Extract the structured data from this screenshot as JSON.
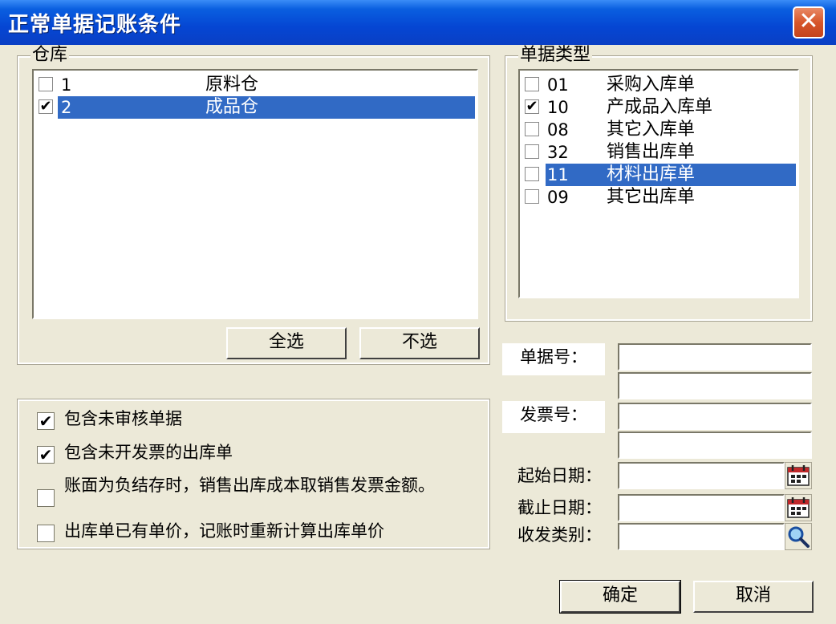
{
  "window": {
    "title": "正常单据记账条件",
    "close_glyph": "✕"
  },
  "warehouse": {
    "label": "仓库",
    "items": [
      {
        "code": "1",
        "name": "原料仓",
        "checked": false,
        "selected": false
      },
      {
        "code": "2",
        "name": "成品仓",
        "checked": true,
        "selected": true
      }
    ],
    "select_all": "全选",
    "select_none": "不选"
  },
  "doc_types": {
    "label": "单据类型",
    "items": [
      {
        "code": "01",
        "name": "采购入库单",
        "checked": false,
        "selected": false
      },
      {
        "code": "10",
        "name": "产成品入库单",
        "checked": true,
        "selected": false
      },
      {
        "code": "08",
        "name": "其它入库单",
        "checked": false,
        "selected": false
      },
      {
        "code": "32",
        "name": "销售出库单",
        "checked": false,
        "selected": false
      },
      {
        "code": "11",
        "name": "材料出库单",
        "checked": false,
        "selected": true
      },
      {
        "code": "09",
        "name": "其它出库单",
        "checked": false,
        "selected": false
      }
    ]
  },
  "options": [
    {
      "label": "包含未审核单据",
      "checked": true
    },
    {
      "label": "包含未开发票的出库单",
      "checked": true
    },
    {
      "label": "账面为负结存时，销售出库成本取销售发票金额。",
      "checked": false
    },
    {
      "label": "出库单已有单价，记账时重新计算出库单价",
      "checked": false
    }
  ],
  "fields": {
    "doc_no_label": "单据号：",
    "invoice_no_label": "发票号：",
    "start_date_label": "起始日期：",
    "end_date_label": "截止日期：",
    "category_label": "收发类别："
  },
  "buttons": {
    "ok": "确定",
    "cancel": "取消"
  },
  "check_glyph": "✔"
}
